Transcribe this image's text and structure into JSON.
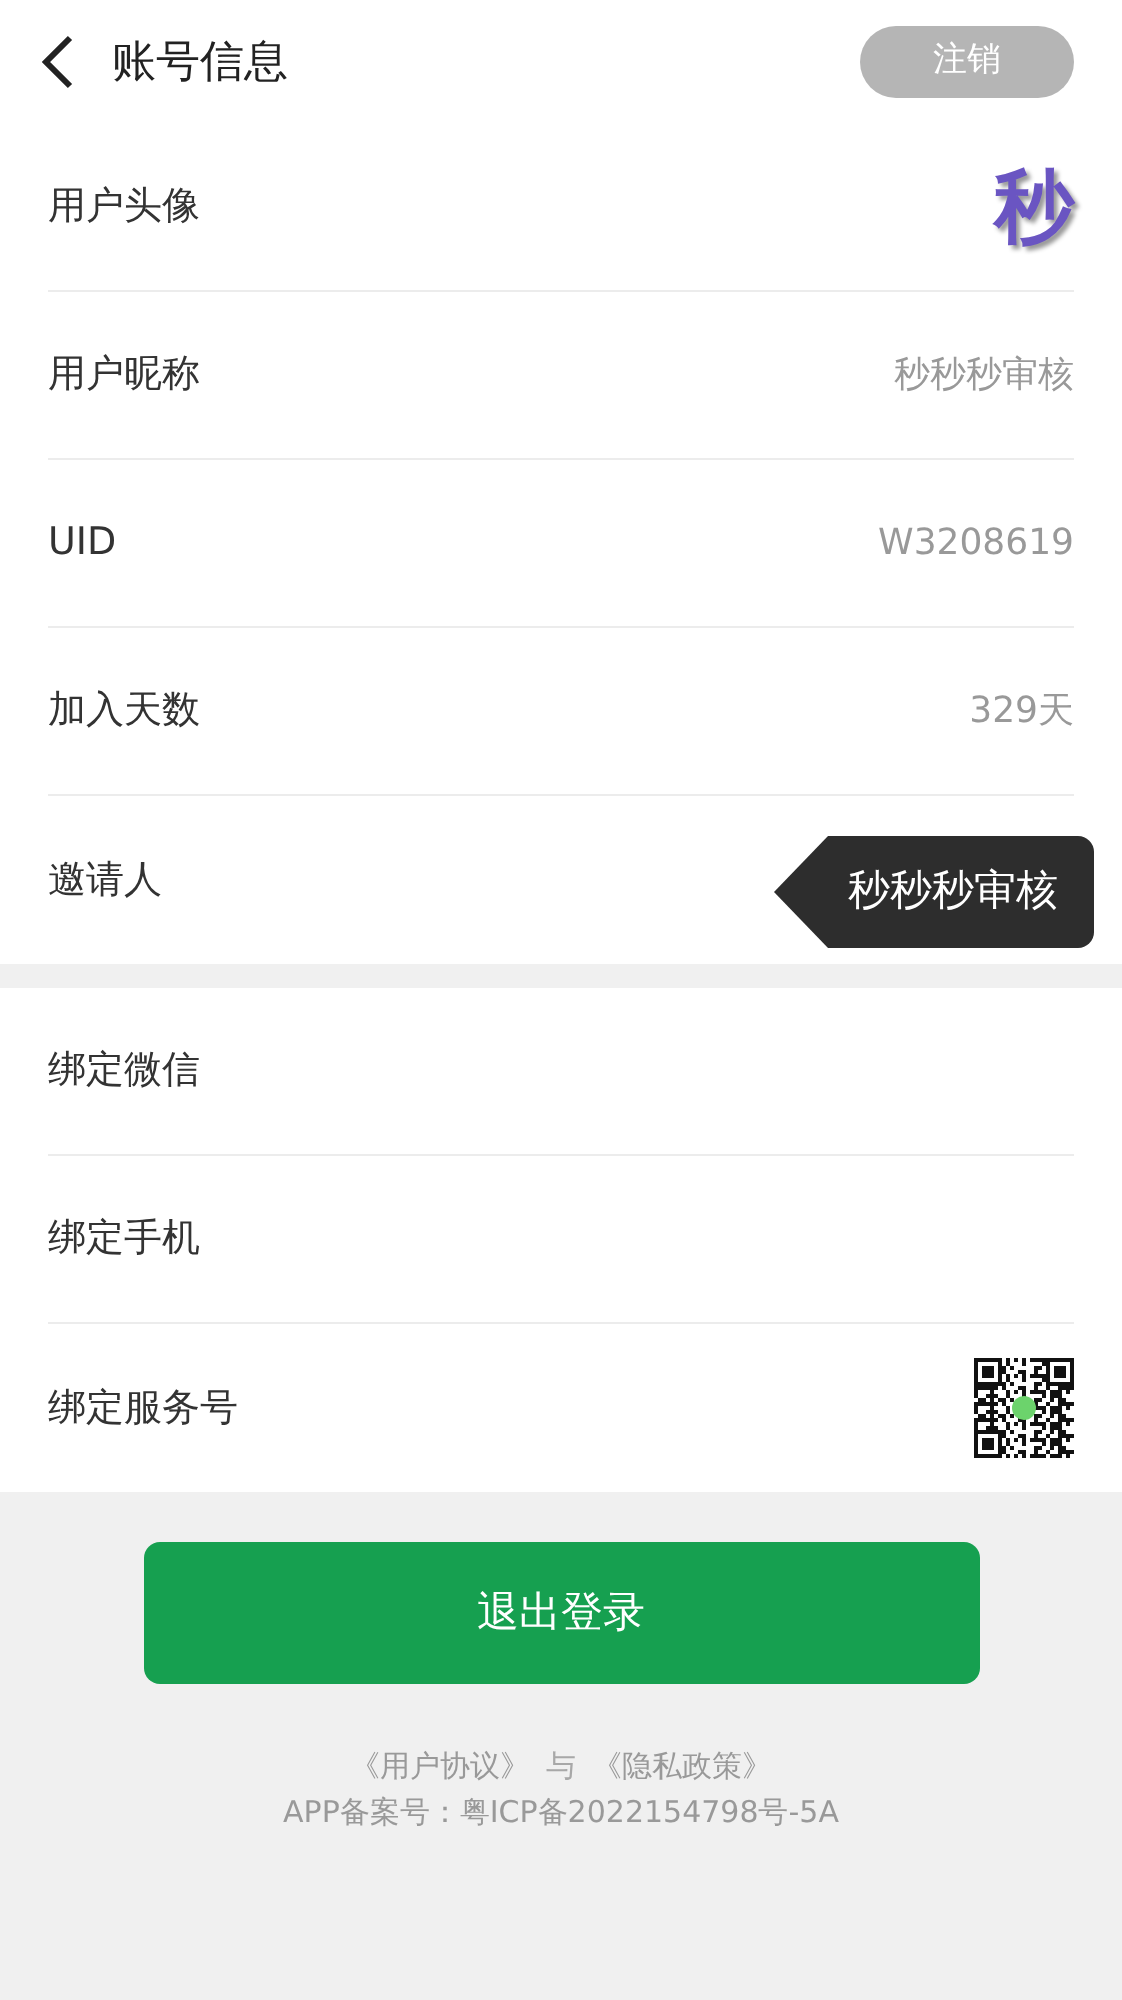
{
  "header": {
    "title": "账号信息",
    "action": "注销"
  },
  "groups": [
    {
      "rows": [
        {
          "kind": "avatar",
          "label": "用户头像",
          "value": "秒"
        },
        {
          "kind": "text",
          "label": "用户昵称",
          "value": "秒秒秒审核"
        },
        {
          "kind": "text",
          "label": "UID",
          "value": "W3208619"
        },
        {
          "kind": "text",
          "label": "加入天数",
          "value": "329天"
        },
        {
          "kind": "tooltip",
          "label": "邀请人",
          "value": "秒秒秒审核"
        }
      ]
    },
    {
      "rows": [
        {
          "kind": "empty",
          "label": "绑定微信"
        },
        {
          "kind": "empty",
          "label": "绑定手机"
        },
        {
          "kind": "qr",
          "label": "绑定服务号"
        }
      ]
    }
  ],
  "logout": "退出登录",
  "footer": {
    "agreement": "《用户协议》",
    "joiner": "与",
    "privacy": "《隐私政策》",
    "record": "APP备案号：粤ICP备2022154798号-5A"
  }
}
